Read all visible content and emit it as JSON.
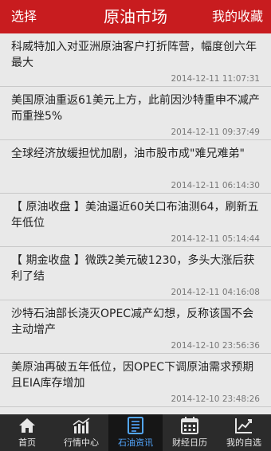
{
  "header": {
    "left_label": "选择",
    "title": "原油市场",
    "right_label": "我的收藏"
  },
  "news": [
    {
      "headline": "科威特加入对亚洲原油客户打折阵营，幅度创六年最大",
      "time": "2014-12-11 11:07:31"
    },
    {
      "headline": "美国原油重返61美元上方，此前因沙特重申不减产而重挫5%",
      "time": "2014-12-11 09:37:49"
    },
    {
      "headline": "全球经济放缓担忧加剧，油市股市成\"难兄难弟\"",
      "time": "2014-12-11 06:14:30"
    },
    {
      "headline": "【 原油收盘 】美油逼近60关口布油测64，刷新五年低位",
      "time": "2014-12-11 05:14:44"
    },
    {
      "headline": "【 期金收盘 】微跌2美元破1230，多头大涨后获利了结",
      "time": "2014-12-11 04:16:08"
    },
    {
      "headline": "沙特石油部长浇灭OPEC减产幻想，反称该国不会主动增产",
      "time": "2014-12-10 23:56:36"
    },
    {
      "headline": "美原油再破五年低位，因OPEC下调原油需求预期且EIA库存增加",
      "time": "2014-12-10 23:48:26"
    }
  ],
  "tabs": [
    {
      "label": "首页",
      "icon": "home-icon"
    },
    {
      "label": "行情中心",
      "icon": "market-chart-icon"
    },
    {
      "label": "石油资讯",
      "icon": "news-icon",
      "active": true
    },
    {
      "label": "财经日历",
      "icon": "calendar-icon"
    },
    {
      "label": "我的自选",
      "icon": "trend-icon"
    }
  ],
  "colors": {
    "header_bg": "#c81c1f",
    "tab_active": "#53a7ff",
    "tabbar_bg": "#2b2b2b"
  }
}
